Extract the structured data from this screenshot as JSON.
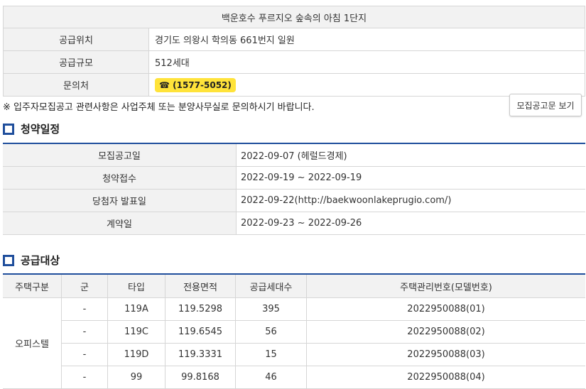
{
  "complex": {
    "title": "백운호수 푸르지오 숲속의 아침 1단지",
    "rows": [
      {
        "label": "공급위치",
        "value": "경기도 의왕시 학의동 661번지 일원"
      },
      {
        "label": "공급규모",
        "value": "512세대"
      },
      {
        "label": "문의처",
        "value": "☎ (1577-5052)"
      }
    ]
  },
  "notice": "※ 입주자모집공고 관련사항은 사업주체 또는 분양사무실로 문의하시기 바랍니다.",
  "notice_button": "모집공고문 보기",
  "schedule": {
    "heading": "청약일정",
    "rows": [
      {
        "label": "모집공고일",
        "value": "2022-09-07 (헤럴드경제)"
      },
      {
        "label": "청약접수",
        "value": "2022-09-19 ~ 2022-09-19"
      },
      {
        "label": "당첨자 발표일",
        "value": "2022-09-22(http://baekwoonlakeprugio.com/)"
      },
      {
        "label": "계약일",
        "value": "2022-09-23 ~ 2022-09-26"
      }
    ]
  },
  "supply": {
    "heading": "공급대상",
    "headers": [
      "주택구분",
      "군",
      "타입",
      "전용면적",
      "공급세대수",
      "주택관리번호(모델번호)"
    ],
    "category": "오피스텔",
    "rows": [
      {
        "group": "-",
        "type": "119A",
        "area": "119.5298",
        "units": "395",
        "id": "2022950088(01)"
      },
      {
        "group": "-",
        "type": "119C",
        "area": "119.6545",
        "units": "56",
        "id": "2022950088(02)"
      },
      {
        "group": "-",
        "type": "119D",
        "area": "119.3331",
        "units": "15",
        "id": "2022950088(03)"
      },
      {
        "group": "-",
        "type": "99",
        "area": "99.8168",
        "units": "46",
        "id": "2022950088(04)"
      }
    ]
  },
  "colors": {
    "accent": "#1f4e9c",
    "phone_badge": "#ffe33a",
    "label_bg": "#f2f2f2"
  }
}
